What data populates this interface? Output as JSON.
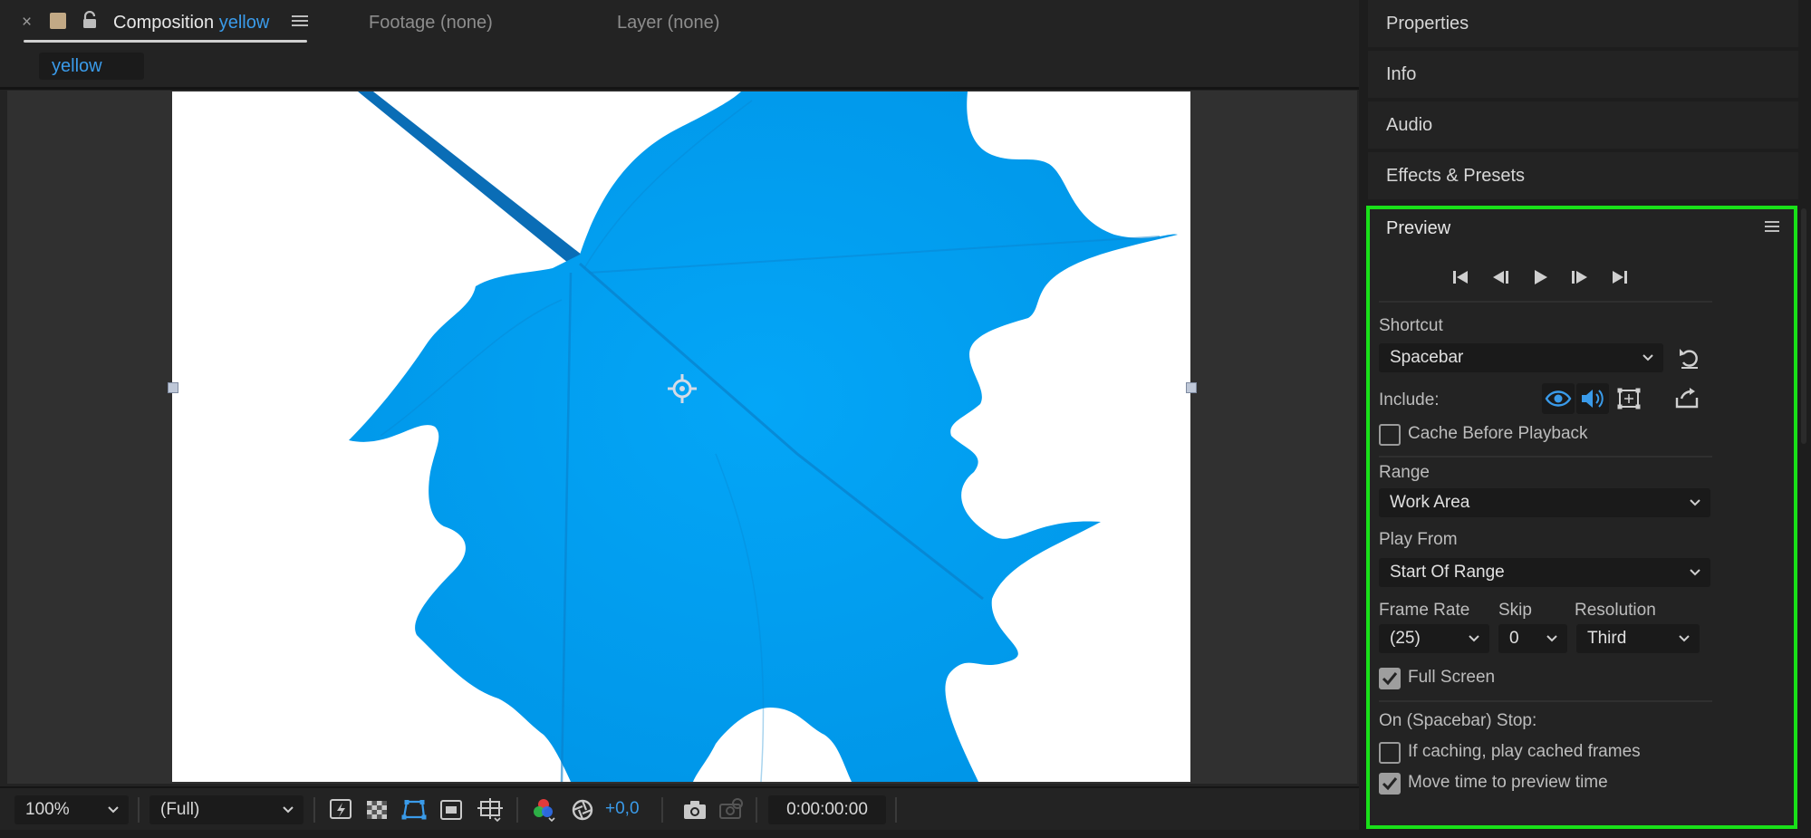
{
  "comp_tabs": {
    "close": "×",
    "title_prefix": "Composition ",
    "title_name": "yellow",
    "footage": "Footage (none)",
    "layer": "Layer (none)"
  },
  "breadcrumb": "yellow",
  "bottom_bar": {
    "zoom": "100%",
    "resolution": "(Full)",
    "exposure": "+0,0",
    "timecode": "0:00:00:00"
  },
  "side_panels": [
    "Properties",
    "Info",
    "Audio",
    "Effects & Presets"
  ],
  "preview": {
    "title": "Preview",
    "shortcut_label": "Shortcut",
    "shortcut_value": "Spacebar",
    "include_label": "Include:",
    "cache_before_playback": "Cache Before Playback",
    "range_label": "Range",
    "range_value": "Work Area",
    "play_from_label": "Play From",
    "play_from_value": "Start Of Range",
    "frame_rate_label": "Frame Rate",
    "frame_rate_value": "(25)",
    "skip_label": "Skip",
    "skip_value": "0",
    "resolution_label": "Resolution",
    "resolution_value": "Third",
    "full_screen": "Full Screen",
    "on_stop_label": "On (Spacebar) Stop:",
    "if_caching": "If caching, play cached frames",
    "move_time": "Move time to preview time",
    "checks": {
      "cache": false,
      "full_screen": true,
      "if_caching": false,
      "move_time": true
    }
  },
  "colors": {
    "accent": "#3a9bea",
    "leaf": "#00a2f5",
    "highlight_border": "#19e019"
  },
  "icons": [
    "lock-icon",
    "menu-icon",
    "fast-preview-icon",
    "transparency-grid-icon",
    "mask-visibility-icon",
    "region-of-interest-icon",
    "guides-icon",
    "color-channels-icon",
    "exposure-reset-icon",
    "snapshot-icon",
    "show-snapshot-icon",
    "first-frame-icon",
    "previous-frame-icon",
    "play-icon",
    "next-frame-icon",
    "last-frame-icon",
    "reset-icon",
    "video-icon",
    "audio-icon",
    "overlays-icon",
    "export-icon"
  ]
}
